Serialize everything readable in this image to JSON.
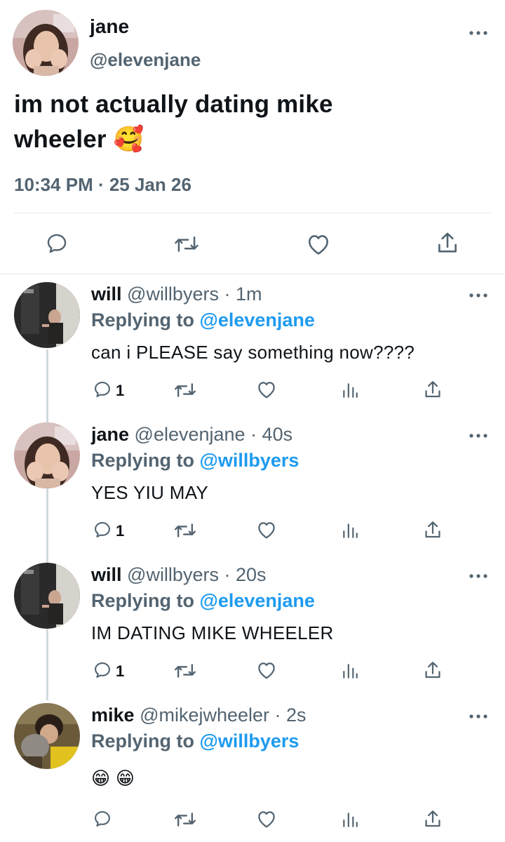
{
  "main_tweet": {
    "name": "jane",
    "handle": "@elevenjane",
    "text_line1": "im not actually dating mike",
    "text_line2": "wheeler",
    "emoji": "🥰",
    "timestamp": "10:34 PM · 25 Jan 26"
  },
  "replies": [
    {
      "name": "will",
      "meta": "@willbyers · 1m",
      "replying_prefix": "Replying to",
      "replying_to": "@elevenjane",
      "text": "can i PLEASE say something now????",
      "reply_count": "1"
    },
    {
      "name": "jane",
      "meta": "@elevenjane · 40s",
      "replying_prefix": "Replying to",
      "replying_to": "@willbyers",
      "text": "YES YIU MAY",
      "reply_count": "1"
    },
    {
      "name": "will",
      "meta": "@willbyers · 20s",
      "replying_prefix": "Replying to",
      "replying_to": "@elevenjane",
      "text": "IM DATING MIKE WHEELER",
      "reply_count": "1"
    },
    {
      "name": "mike",
      "meta": "@mikejwheeler · 2s",
      "replying_prefix": "Replying to",
      "replying_to": "@willbyers",
      "text": "😁 😁",
      "reply_count": ""
    }
  ],
  "icons": {
    "reply": "reply-icon",
    "retweet": "retweet-icon",
    "like": "heart-icon",
    "views": "views-icon",
    "share": "share-icon",
    "more": "more-icon"
  },
  "colors": {
    "accent": "#1d9bf0",
    "secondary_text": "#536471",
    "divider": "#e6e9ec"
  }
}
